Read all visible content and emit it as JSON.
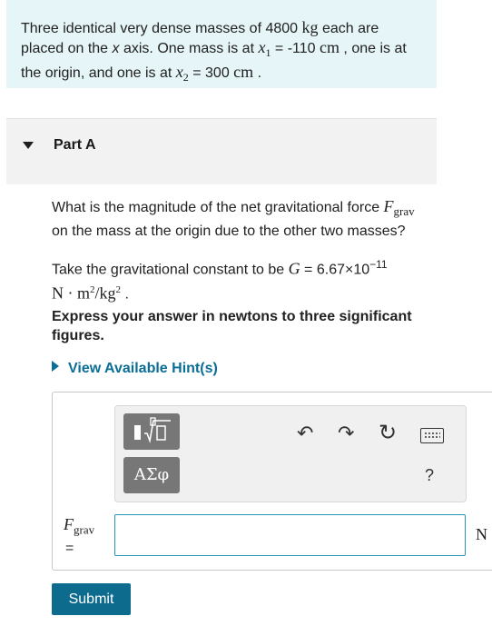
{
  "problem": {
    "t1": "Three identical very dense masses of 4800 ",
    "u_kg": "kg",
    "t2": " each are placed on the ",
    "x_var": "x",
    "t3": " axis. One mass is at ",
    "x1_sym": "x",
    "x1_sub": "1",
    "x1_val": " = -110 ",
    "u_cm1": "cm",
    "t4": " , one is at the origin, and one is at ",
    "x2_sym": "x",
    "x2_sub": "2",
    "x2_val": " = 300 ",
    "u_cm2": "cm",
    "t5": " ."
  },
  "part": {
    "title": "Part A"
  },
  "question": {
    "t1": "What is the magnitude of the net gravitational force ",
    "f_sym": "F",
    "f_sub": "grav",
    "t2": " on the mass at the origin due to the other two masses?"
  },
  "constant": {
    "t1": "Take the gravitational constant to be ",
    "g_sym": "G",
    "t2": " = 6.67×10",
    "exp": "−11",
    "unit_n": "N · m",
    "unit_sup2": "2",
    "unit_kg": "/kg",
    "unit_sup2b": "2",
    "t3": " ."
  },
  "instruction": "Express your answer in newtons to three significant figures.",
  "hint": {
    "label": "View Available Hint(s)"
  },
  "toolbar": {
    "templates_label": "▮√▯",
    "greek_label": "ΑΣφ",
    "undo_icon": "↶",
    "redo_icon": "↷",
    "reset_icon": "↻",
    "help_label": "?"
  },
  "answer": {
    "var_sym": "F",
    "var_sub": "grav",
    "equals": "=",
    "value": "",
    "unit": "N"
  },
  "submit": {
    "label": "Submit"
  }
}
